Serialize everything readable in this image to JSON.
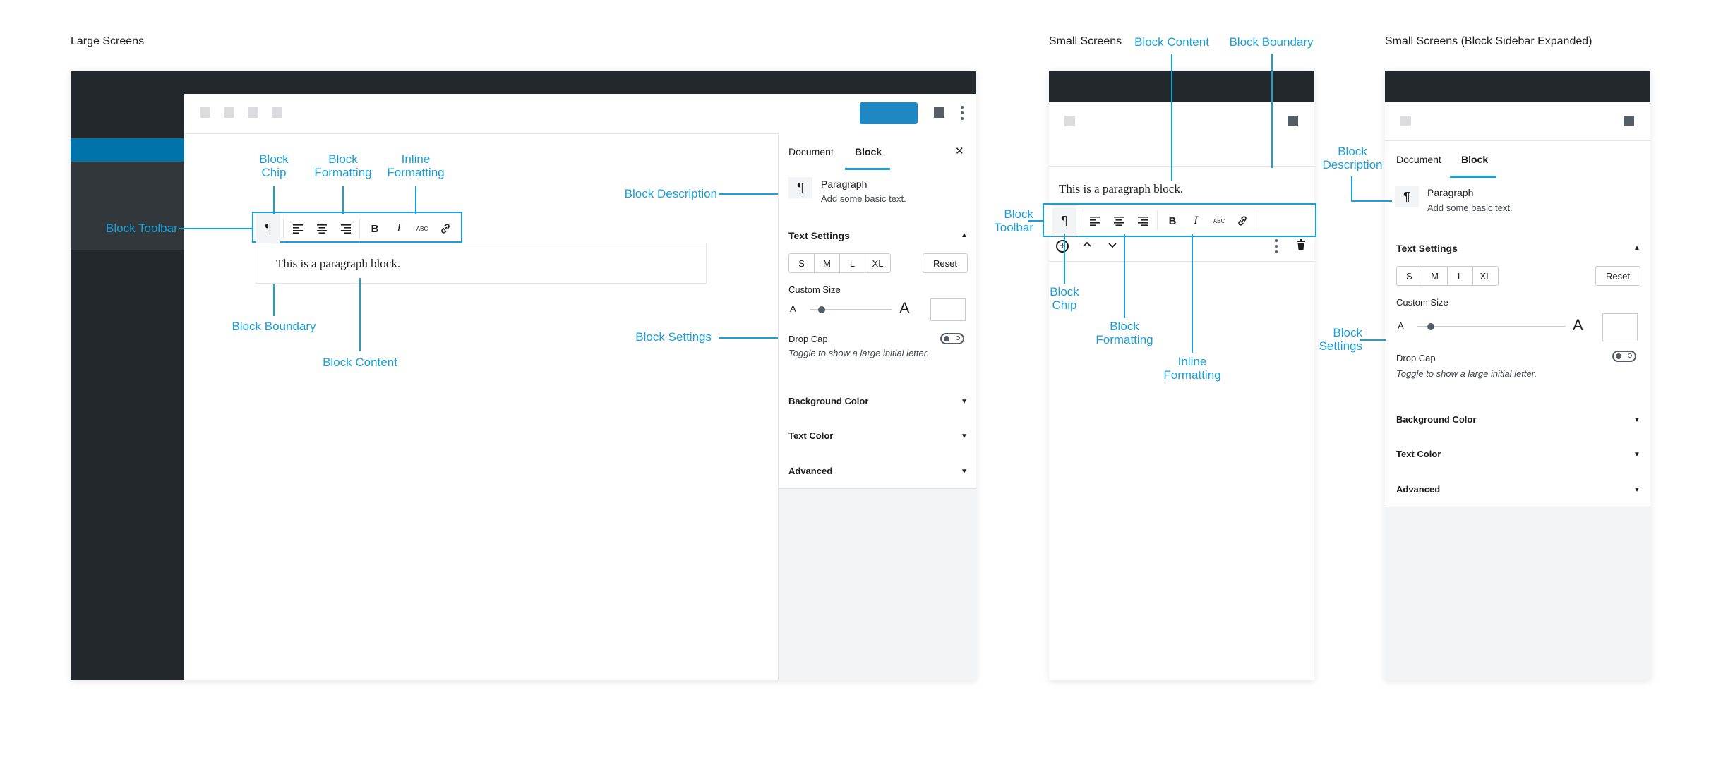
{
  "sections": {
    "large": "Large Screens",
    "small": "Small Screens",
    "small_expanded": "Small Screens (Block Sidebar Expanded)"
  },
  "colors": {
    "annotation": "#1aa0d8",
    "dark_bar": "#23282d",
    "active_nav": "#0073aa",
    "publish_button": "#1e88c4"
  },
  "icons": {
    "paragraph": "¶",
    "close": "✕",
    "bold": "B",
    "italic": "I",
    "strikethrough": "ABC",
    "caret_up": "▲",
    "caret_down": "▼"
  },
  "annotations_large": {
    "block_chip": "Block\nChip",
    "block_formatting": "Block\nFormatting",
    "inline_formatting": "Inline\nFormatting",
    "block_toolbar": "Block Toolbar",
    "block_boundary": "Block Boundary",
    "block_content": "Block Content",
    "block_description": "Block Description",
    "block_settings": "Block Settings"
  },
  "annotations_small": {
    "block_content": "Block Content",
    "block_boundary": "Block Boundary",
    "block_toolbar": "Block\nToolbar",
    "block_chip": "Block\nChip",
    "block_formatting": "Block\nFormatting",
    "inline_formatting": "Inline\nFormatting"
  },
  "annotations_expanded": {
    "block_description": "Block\nDescription",
    "block_settings": "Block\nSettings"
  },
  "editor": {
    "paragraph_text": "This is a paragraph block."
  },
  "sidebar": {
    "tab_document": "Document",
    "tab_block": "Block",
    "block_name": "Paragraph",
    "block_desc": "Add some basic text.",
    "text_settings": "Text Settings",
    "sizes": [
      "S",
      "M",
      "L",
      "XL"
    ],
    "reset": "Reset",
    "custom_size": "Custom Size",
    "size_small_glyph": "A",
    "size_large_glyph": "A",
    "drop_cap": "Drop Cap",
    "drop_cap_help": "Toggle to show a large initial letter.",
    "background_color": "Background Color",
    "text_color": "Text Color",
    "advanced": "Advanced"
  }
}
